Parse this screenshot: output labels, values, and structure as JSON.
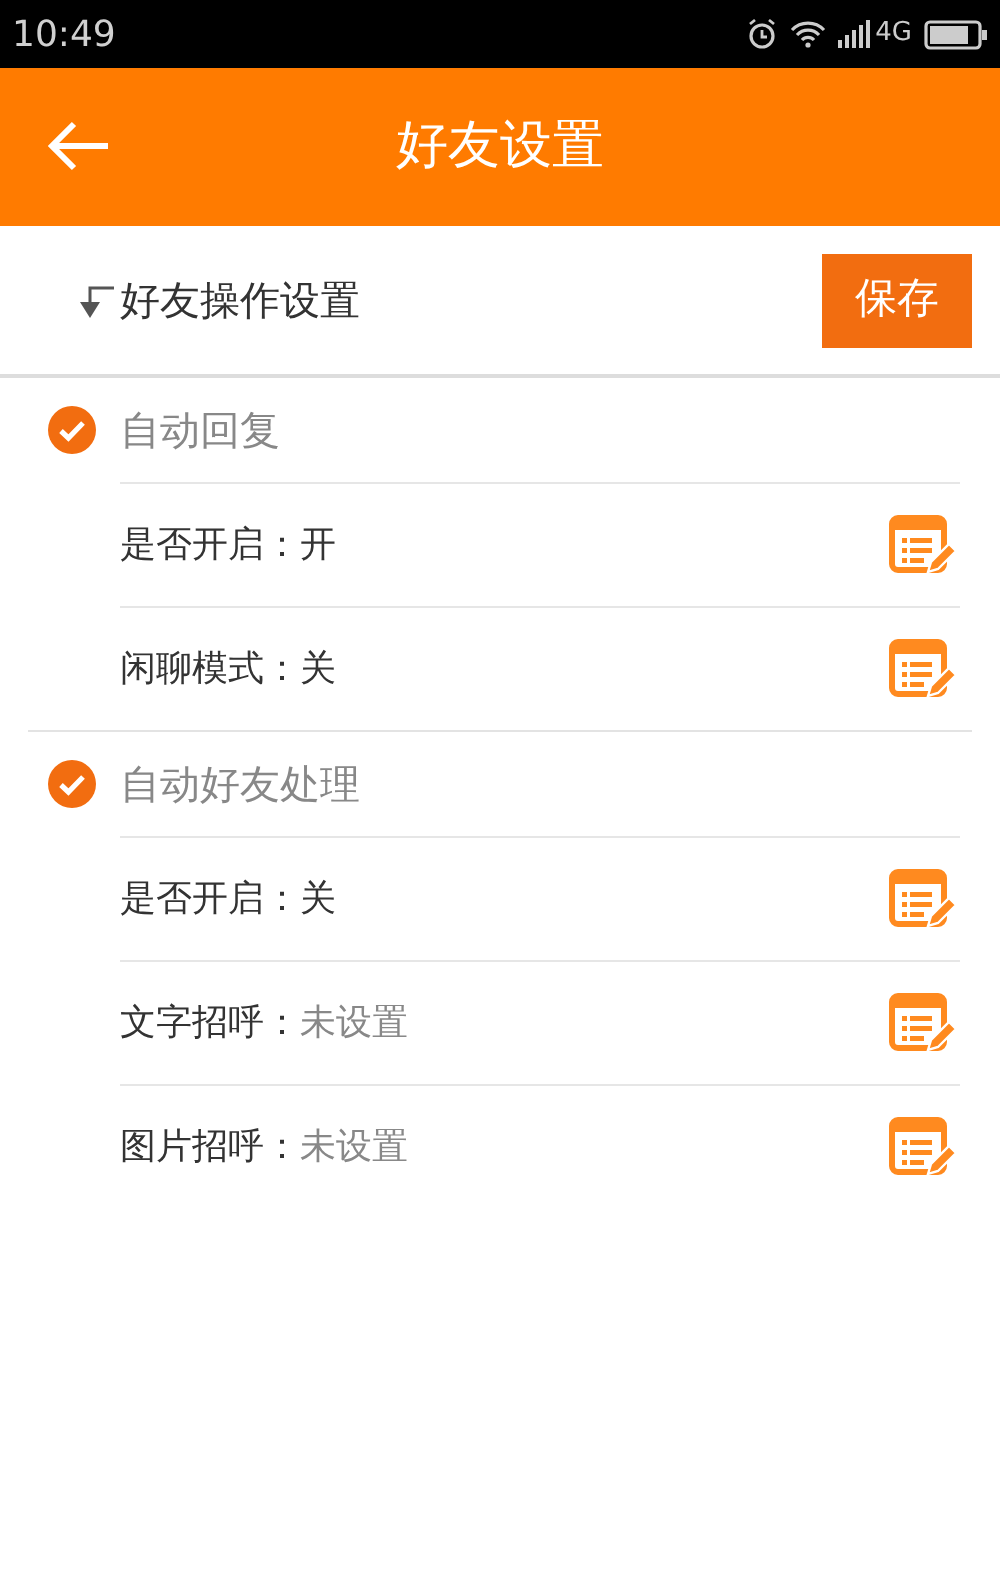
{
  "status_bar": {
    "time": "10:49",
    "network": "4G"
  },
  "header": {
    "title": "好友设置"
  },
  "section": {
    "title": "好友操作设置",
    "save_button": "保存"
  },
  "groups": [
    {
      "title": "自动回复",
      "checked": true,
      "rows": [
        {
          "label": "是否开启：",
          "value": "开",
          "kind": "value"
        },
        {
          "label": "闲聊模式：",
          "value": "关",
          "kind": "value"
        }
      ]
    },
    {
      "title": "自动好友处理",
      "checked": true,
      "rows": [
        {
          "label": "是否开启：",
          "value": "关",
          "kind": "value"
        },
        {
          "label": "文字招呼：",
          "value": "未设置",
          "kind": "hint"
        },
        {
          "label": "图片招呼：",
          "value": "未设置",
          "kind": "hint"
        }
      ]
    }
  ]
}
